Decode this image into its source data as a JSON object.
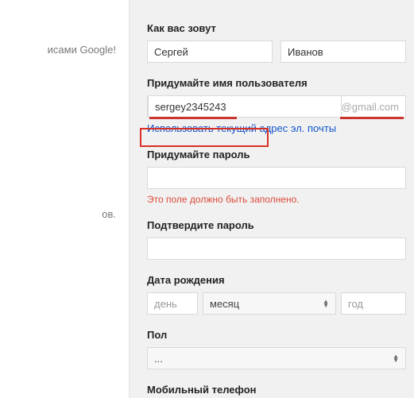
{
  "left": {
    "text1": "исами Google!",
    "text2": "ов."
  },
  "name": {
    "label": "Как вас зовут",
    "first": "Сергей",
    "last": "Иванов"
  },
  "username": {
    "label": "Придумайте имя пользователя",
    "value": "sergey2345243",
    "domain": "@gmail.com",
    "link": "Использовать текущий адрес эл. почты"
  },
  "password": {
    "label": "Придумайте пароль",
    "error": "Это поле должно быть заполнено."
  },
  "confirm": {
    "label": "Подтвердите пароль"
  },
  "dob": {
    "label": "Дата рождения",
    "day_ph": "день",
    "month": "месяц",
    "year_ph": "год"
  },
  "gender": {
    "label": "Пол",
    "value": "..."
  },
  "phone": {
    "label": "Мобильный телефон"
  }
}
